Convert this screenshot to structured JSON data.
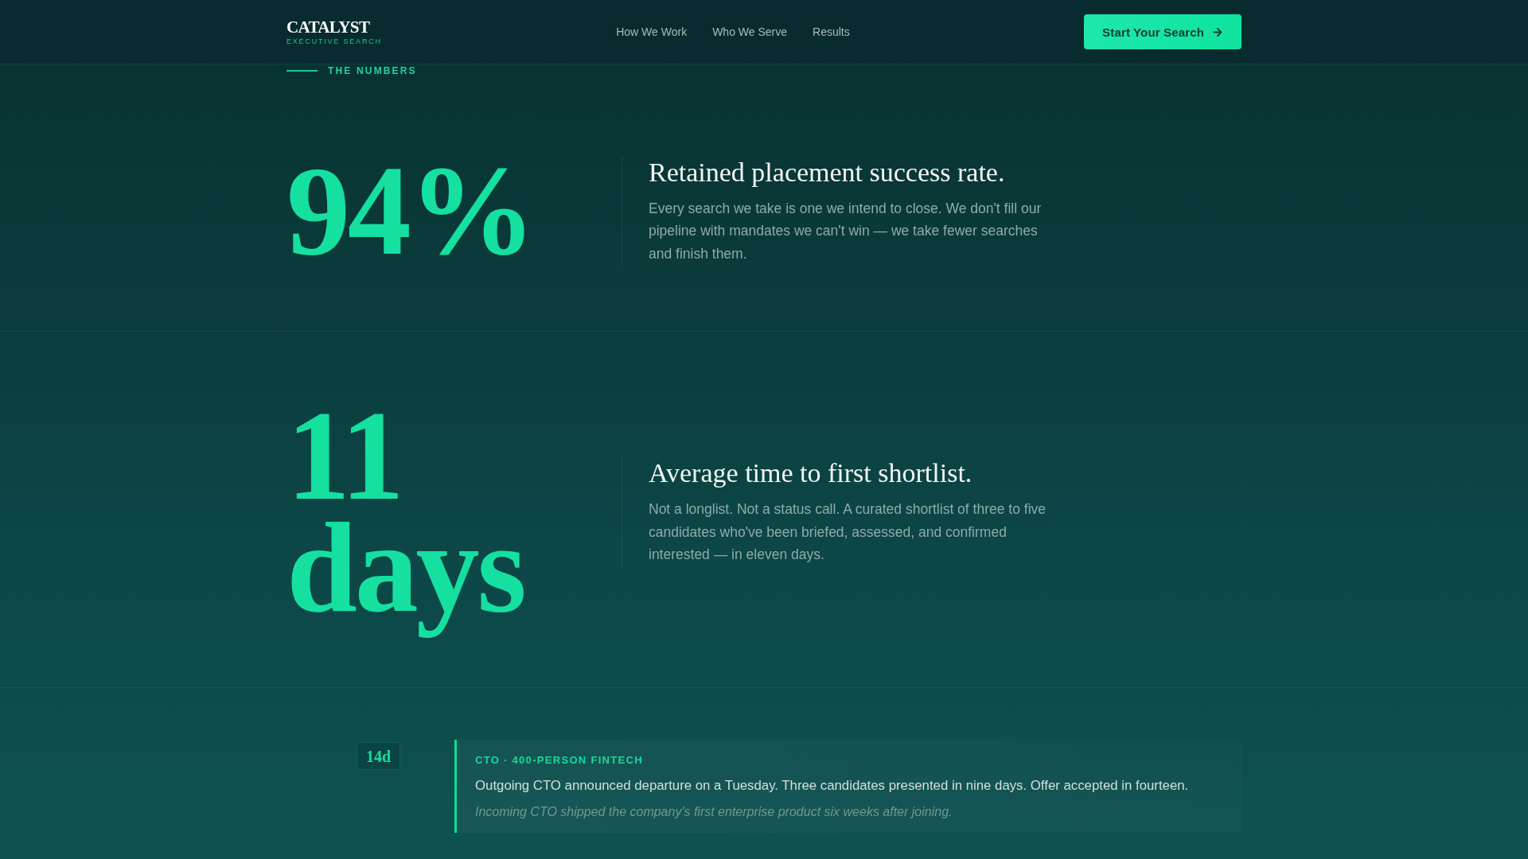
{
  "header": {
    "logo": {
      "wordmark": "CATALYST",
      "tagline": "EXECUTIVE SEARCH"
    },
    "nav": [
      "How We Work",
      "Who We Serve",
      "Results"
    ],
    "cta": "Start Your Search"
  },
  "numbers": {
    "eyebrow": "THE NUMBERS",
    "stats": [
      {
        "figure": "94%",
        "title": "Retained placement success rate.",
        "description": "Every search we take is one we intend to close. We don't fill our pipeline with mandates we can't win — we take fewer searches and finish them."
      },
      {
        "figure": "11 days",
        "title": "Average time to first shortlist.",
        "description": "Not a longlist. Not a status call. A curated shortlist of three to five candidates who've been briefed, assessed, and confirmed interested — in eleven days."
      }
    ]
  },
  "case_study": {
    "badge": "14d",
    "role": "CTO · 400-PERSON FINTECH",
    "summary": "Outgoing CTO announced departure on a Tuesday. Three candidates presented in nine days. Offer accepted in fourteen.",
    "outcome": "Incoming CTO shipped the company's first enterprise product six weeks after joining."
  }
}
